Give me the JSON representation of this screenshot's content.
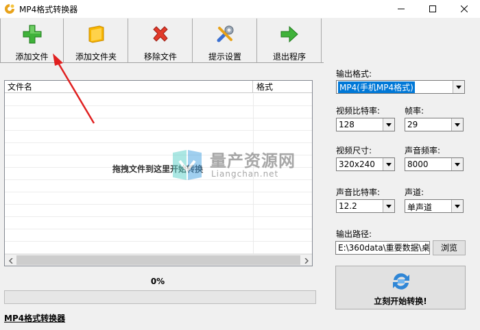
{
  "window": {
    "title": "MP4格式转换器"
  },
  "toolbar": {
    "add_file": "添加文件",
    "add_folder": "添加文件夹",
    "remove_file": "移除文件",
    "settings": "提示设置",
    "exit": "退出程序"
  },
  "file_list": {
    "columns": [
      "文件名",
      "格式"
    ],
    "drop_hint": "拖拽文件到这里开始转换"
  },
  "progress": {
    "text": "0%",
    "value": 0
  },
  "footer": {
    "link": "MP4格式转换器"
  },
  "settings": {
    "output_format": {
      "label": "输出格式:",
      "value": "MP4(手机MP4格式)"
    },
    "video_bitrate": {
      "label": "视频比特率:",
      "value": "128"
    },
    "frame_rate": {
      "label": "帧率:",
      "value": "29"
    },
    "video_size": {
      "label": "视频尺寸:",
      "value": "320x240"
    },
    "sample_rate": {
      "label": "声音频率:",
      "value": "8000"
    },
    "audio_bitrate": {
      "label": "声音比特率:",
      "value": "12.2"
    },
    "channel": {
      "label": "声道:",
      "value": "单声道"
    },
    "output_path": {
      "label": "输出路径:",
      "value": "E:\\360data\\重要数据\\桌",
      "browse": "浏览"
    }
  },
  "start_button": {
    "label": "立刻开始转换!"
  },
  "watermark": {
    "title": "量产资源网",
    "subtitle": "Liangchan.net"
  },
  "colors": {
    "selection": "#0078d7",
    "annotation_arrow": "#e02020",
    "progress_fill": "#06b025"
  }
}
